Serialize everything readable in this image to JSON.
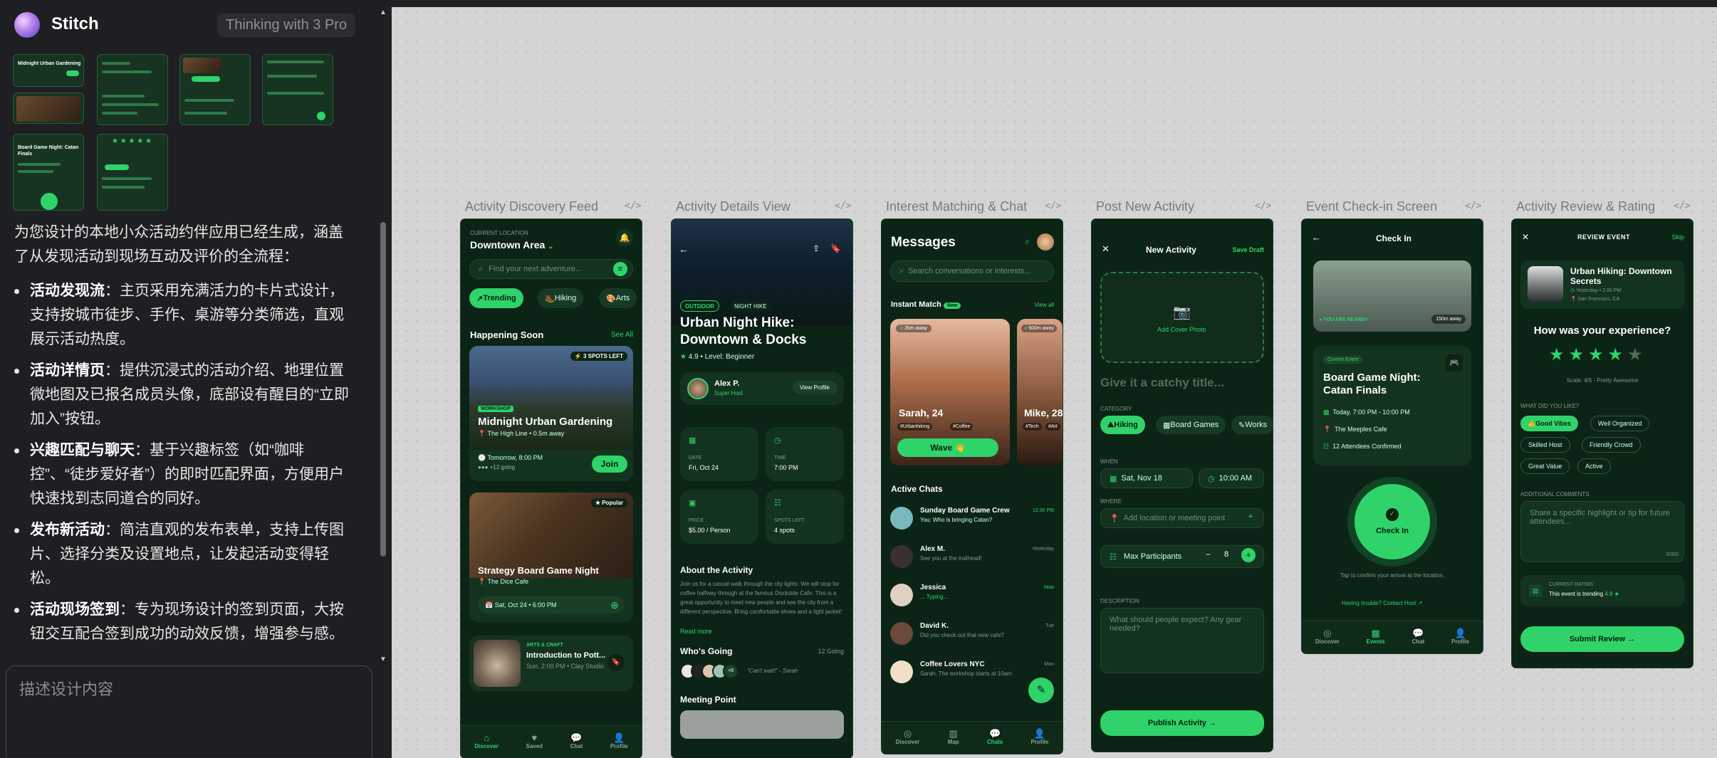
{
  "app": {
    "name": "Stitch",
    "mode": "Thinking with 3 Pro"
  },
  "thumbs": {
    "t1": "Midnight Urban Gardening",
    "t2": "Board Game Night: Catan Finals"
  },
  "summary": {
    "intro": "为您设计的本地小众活动约伴应用已经生成，涵盖了从发现活动到现场互动及评价的全流程：",
    "items": [
      {
        "title": "活动发现流",
        "text": "：主页采用充满活力的卡片式设计，支持按城市徒步、手作、桌游等分类筛选，直观展示活动热度。"
      },
      {
        "title": "活动详情页",
        "text": "：提供沉浸式的活动介绍、地理位置微地图及已报名成员头像，底部设有醒目的“立即加入”按钮。"
      },
      {
        "title": "兴趣匹配与聊天",
        "text": "：基于兴趣标签（如“咖啡控”、“徒步爱好者”）的即时匹配界面，方便用户快速找到志同道合的同好。"
      },
      {
        "title": "发布新活动",
        "text": "：简洁直观的发布表单，支持上传图片、选择分类及设置地点，让发起活动变得轻松。"
      },
      {
        "title": "活动现场签到",
        "text": "：专为现场设计的签到页面，大按钮交互配合签到成功的动效反馈，增强参与感。"
      }
    ]
  },
  "prompt": {
    "placeholder": "描述设计内容"
  },
  "labels": [
    "Activity Discovery Feed",
    "Activity Details View",
    "Interest Matching & Chat",
    "Post New Activity",
    "Event Check-in Screen",
    "Activity Review & Rating"
  ],
  "code_icon": "</>",
  "discovery": {
    "loc_label": "CURRENT LOCATION",
    "loc": "Downtown Area",
    "search": "Find your next adventure...",
    "chips": [
      "Trending",
      "Hiking",
      "Arts"
    ],
    "section": "Happening Soon",
    "see_all": "See All",
    "c1": {
      "badge": "3 SPOTS LEFT",
      "tag": "WORKSHOP",
      "title": "Midnight Urban Gardening",
      "place": "The High Line • 0.5m away",
      "time": "Tomorrow, 8:00 PM",
      "going": "+12 going",
      "join": "Join"
    },
    "c2": {
      "badge": "Popular",
      "title": "Strategy Board Game Night",
      "place": "The Dice Cafe",
      "time": "Sat, Oct 24 • 6:00 PM"
    },
    "c3": {
      "tag": "ARTS & CRAFT",
      "title": "Introduction to Pott...",
      "time": "Sun, 2:00 PM • Clay Studio"
    },
    "tabs": [
      "Discover",
      "Saved",
      "Chat",
      "Profile"
    ]
  },
  "details": {
    "tags": [
      "OUTDOOR",
      "NIGHT HIKE"
    ],
    "title": "Urban Night Hike: Downtown & Docks",
    "rating": "4.9",
    "level": "Level: Beginner",
    "host": "Alex P.",
    "host_role": "Super Host",
    "view_profile": "View Profile",
    "tiles": [
      {
        "k": "DATE",
        "v": "Fri, Oct 24"
      },
      {
        "k": "TIME",
        "v": "7:00 PM"
      },
      {
        "k": "PRICE",
        "v": "$5.00 / Person"
      },
      {
        "k": "SPOTS LEFT",
        "v": "4 spots"
      }
    ],
    "about_h": "About the Activity",
    "about": "Join us for a casual walk through the city lights. We will stop for coffee halfway through at the famous Dockside Cafe. This is a great opportunity to meet new people and see the city from a different perspective. Bring comfortable shoes and a light jacket!",
    "read_more": "Read more",
    "going_h": "Who's Going",
    "going_n": "12 Going",
    "more_avatars": "+8",
    "quote": "\"Can't wait!\" - Sarah",
    "meet_h": "Meeting Point"
  },
  "chat": {
    "title": "Messages",
    "search": "Search conversations or interests...",
    "instant": "Instant Match",
    "new": "New",
    "view_all": "View all",
    "m1": {
      "dist": "2km away",
      "name": "Sarah, 24",
      "tags": [
        "#Urbanhiking",
        "#Coffee"
      ],
      "wave": "Wave 👋"
    },
    "m2": {
      "dist": "500m away",
      "name": "Mike, 28",
      "tags": [
        "#Tech",
        "#Art"
      ]
    },
    "active": "Active Chats",
    "chats": [
      {
        "name": "Sunday Board Game Crew",
        "msg": "You: Who is bringing Catan?",
        "time": "12:30 PM"
      },
      {
        "name": "Alex M.",
        "msg": "See you at the trailhead!",
        "time": "Yesterday"
      },
      {
        "name": "Jessica",
        "msg": "... Typing...",
        "time": "Now"
      },
      {
        "name": "David K.",
        "msg": "Did you check out that new cafe?",
        "time": "Tue"
      },
      {
        "name": "Coffee Lovers NYC",
        "msg": "Sarah: The workshop starts at 10am",
        "time": "Mon"
      }
    ],
    "tabs": [
      "Discover",
      "Map",
      "Chats",
      "Profile"
    ]
  },
  "post": {
    "title": "New Activity",
    "save": "Save Draft",
    "cover": "Add Cover Photo",
    "name_ph": "Give it a catchy title...",
    "cat": "CATEGORY",
    "cats": [
      "Hiking",
      "Board Games",
      "Works"
    ],
    "when": "WHEN",
    "date": "Sat, Nov 18",
    "time": "10:00 AM",
    "where": "WHERE",
    "addr": "Add location or meeting point",
    "max": "Max Participants",
    "max_n": "8",
    "desc": "DESCRIPTION",
    "desc_ph": "What should people expect? Any gear needed?",
    "publish": "Publish Activity"
  },
  "checkin": {
    "title": "Check In",
    "nearby": "YOU ARE NEARBY",
    "dist": "150m away",
    "current": "Current Event",
    "event": "Board Game Night: Catan Finals",
    "time": "Today, 7:00 PM - 10:00 PM",
    "place": "The Meeples Cafe",
    "att": "12 Attendees Confirmed",
    "btn": "Check In",
    "tap": "Tap to confirm your arrival at the location.",
    "help": "Having trouble? Contact Host",
    "tabs": [
      "Discover",
      "Events",
      "Chat",
      "Profile"
    ]
  },
  "review": {
    "title": "REVIEW EVENT",
    "skip": "Skip",
    "event": "Urban Hiking: Downtown Secrets",
    "when": "Yesterday • 2:00 PM",
    "where": "San Francisco, CA",
    "q": "How was your experience?",
    "rating": 4,
    "scale": "Scale: 4/5 - Pretty Awesome",
    "like_h": "WHAT DID YOU LIKE?",
    "likes": [
      "Good Vibes",
      "Well Organized",
      "Skilled Host",
      "Friendly Crowd",
      "Great Value",
      "Active"
    ],
    "comments_h": "ADDITIONAL COMMENTS",
    "comments_ph": "Share a specific highlight or tip for future attendees...",
    "count": "0/300",
    "cur_h": "CURRENT RATING",
    "cur": "This event is trending",
    "cur_v": "4.8 ★",
    "submit": "Submit Review"
  },
  "colors": {
    "accent": "#2fd36a",
    "screen_bg": "#0c2416",
    "panel": "#1e1f22"
  }
}
